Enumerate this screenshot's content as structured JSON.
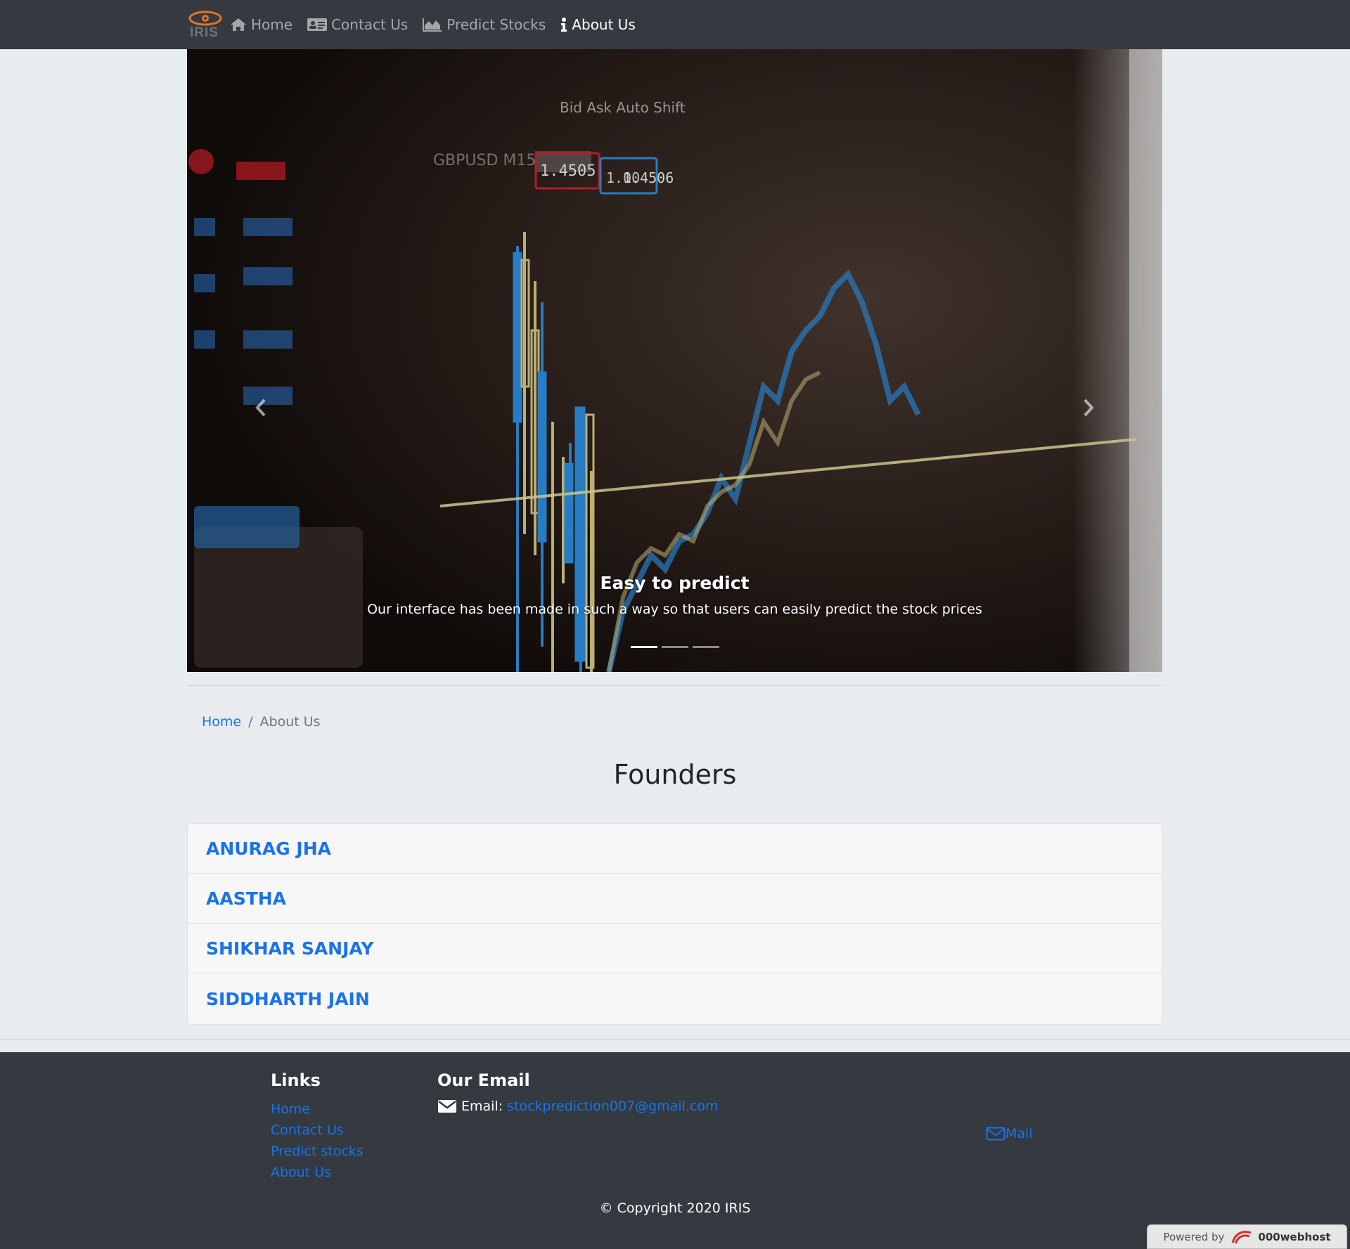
{
  "nav": {
    "brand_text": "IRIS",
    "links": [
      {
        "label": "Home",
        "icon": "home-icon"
      },
      {
        "label": "Contact Us",
        "icon": "contact-card-icon"
      },
      {
        "label": "Predict Stocks",
        "icon": "area-chart-icon"
      },
      {
        "label": "About Us",
        "icon": "info-icon",
        "active": true
      }
    ]
  },
  "carousel": {
    "caption_title": "Easy to predict",
    "caption_text": "Our interface has been made in such a way so that users can easily predict the stock prices",
    "slides": 3,
    "active_slide": 1
  },
  "breadcrumb": {
    "home": "Home",
    "divider": "/",
    "current": "About Us"
  },
  "title": "Founders",
  "founders": [
    "ANURAG JHA",
    "AASTHA",
    "SHIKHAR SANJAY",
    "SIDDHARTH JAIN"
  ],
  "footer": {
    "links_heading": "Links",
    "links": [
      "Home",
      "Contact Us",
      "Predict stocks",
      "About Us"
    ],
    "email_heading": "Our Email",
    "email_label": "Email:",
    "email_address": "stockprediction007@gmail.com",
    "mail_link": "Mail",
    "copyright": "© Copyright 2020 IRIS"
  },
  "powered": {
    "prefix": "Powered by",
    "brand": "000webhost"
  },
  "colors": {
    "navbar_bg": "#343a40",
    "link": "#1a73e8",
    "page_bg": "#e9ecef"
  }
}
